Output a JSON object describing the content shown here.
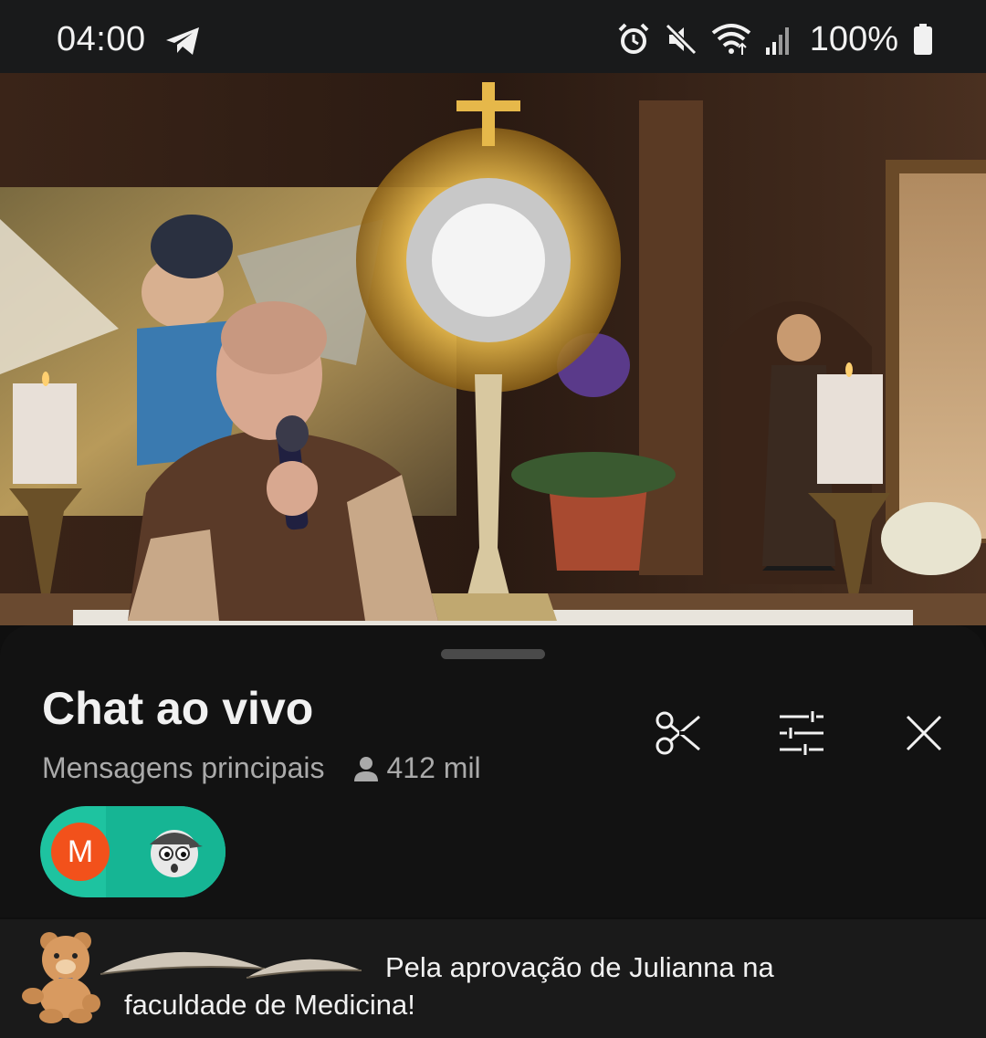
{
  "status_bar": {
    "time": "04:00",
    "battery": "100%",
    "icons": [
      "telegram-icon",
      "alarm-icon",
      "mute-icon",
      "wifi-icon",
      "signal-icon",
      "battery-icon"
    ]
  },
  "video": {
    "description_icon": "video-player"
  },
  "chat": {
    "title": "Chat ao vivo",
    "mode": "Mensagens principais",
    "viewers": "412 mil",
    "actions": [
      "clip-icon",
      "filter-icon",
      "close-icon"
    ],
    "participants": [
      {
        "initial": "M",
        "color": "#f2511b"
      },
      {
        "initial": "",
        "icon": "cartoon-avatar"
      }
    ]
  },
  "message": {
    "text_line1": "Pela aprovação de Julianna na",
    "text_line2": "faculdade de Medicina!"
  },
  "colors": {
    "background": "#0f0f0f",
    "status_bar": "#191a1b",
    "accent_pill": "#1ec3a0"
  }
}
